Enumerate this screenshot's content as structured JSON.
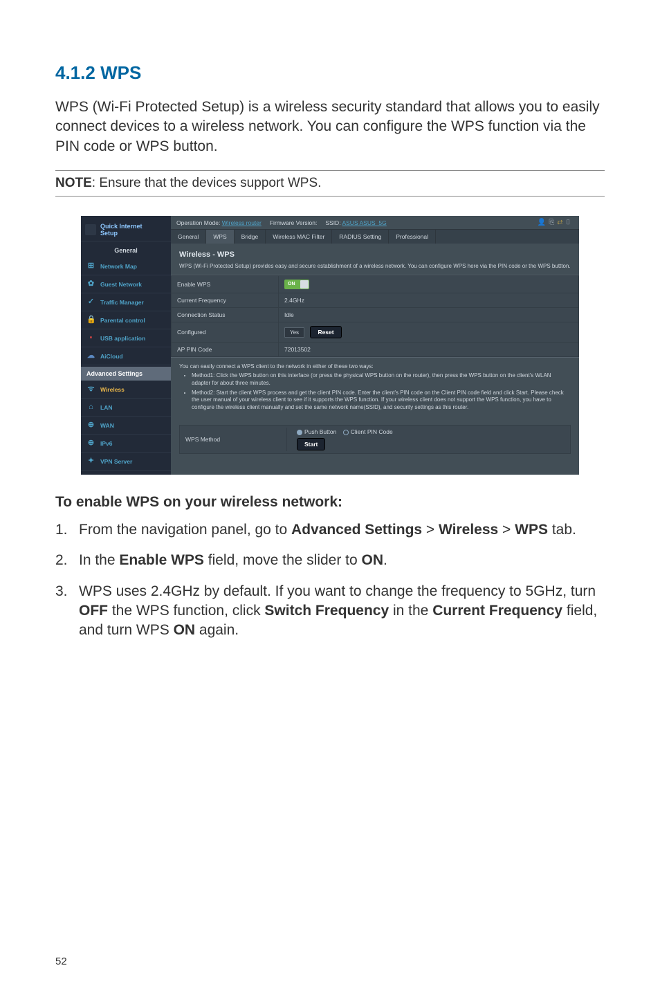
{
  "section": {
    "number": "4.1.2",
    "title": "WPS",
    "intro": "WPS (Wi-Fi Protected Setup) is a wireless security standard that allows you to easily connect devices to a wireless network. You can configure the WPS function via the PIN code or WPS button."
  },
  "note": {
    "label": "NOTE",
    "text": ":  Ensure that the devices support WPS."
  },
  "screenshot": {
    "sidebar": {
      "qis_l1": "Quick Internet",
      "qis_l2": "Setup",
      "group_general": "General",
      "items_general": [
        "Network Map",
        "Guest Network",
        "Traffic Manager",
        "Parental control",
        "USB application",
        "AiCloud"
      ],
      "group_adv": "Advanced Settings",
      "items_adv": [
        "Wireless",
        "LAN",
        "WAN",
        "IPv6",
        "VPN Server"
      ]
    },
    "topbar": {
      "opmode_label": "Operation Mode:",
      "opmode_value": "Wireless router",
      "fw_label": "Firmware Version:",
      "ssid_label": "SSID:",
      "ssid_value": "ASUS  ASUS_5G"
    },
    "tabs": [
      "General",
      "WPS",
      "Bridge",
      "Wireless MAC Filter",
      "RADIUS Setting",
      "Professional"
    ],
    "page_title": "Wireless - WPS",
    "page_desc": "WPS (Wi-Fi Protected Setup) provides easy and secure establishment of a wireless network. You can configure WPS here via the PIN code or the WPS buttton.",
    "rows": {
      "enable_wps": {
        "label": "Enable WPS",
        "value": "ON"
      },
      "current_freq": {
        "label": "Current Frequency",
        "value": "2.4GHz"
      },
      "conn_status": {
        "label": "Connection Status",
        "value": "Idle"
      },
      "configured": {
        "label": "Configured",
        "value": "Yes",
        "btn": "Reset"
      },
      "ap_pin": {
        "label": "AP PIN Code",
        "value": "72013502"
      }
    },
    "methods": {
      "intro": "You can easily connect a WPS client to the network in either of these two ways:",
      "m1": "Method1: Click the WPS button on this interface (or press the physical WPS button on the router), then press the WPS button on the client's WLAN adapter for about three minutes.",
      "m2": "Method2: Start the client WPS process and get the client PIN code. Enter the client's PIN code on the Client PIN code field and click Start. Please check the user manual of your wireless client to see if it supports the WPS function. If your wireless client does not support the WPS function, you have to configure the wireless client manually and set the same network name(SSID), and security settings as this router."
    },
    "wps_method": {
      "label": "WPS Method",
      "r1": "Push Button",
      "r2": "Client PIN Code",
      "start": "Start"
    }
  },
  "instructions": {
    "heading": "To enable WPS on your wireless network:",
    "step1_pre": "From the navigation panel, go to ",
    "step1_b1": "Advanced Settings",
    "step1_gt1": " > ",
    "step1_b2": "Wireless",
    "step1_gt2": " > ",
    "step1_b3": "WPS",
    "step1_post": " tab.",
    "step2_pre": "In the ",
    "step2_b1": "Enable WPS",
    "step2_mid": " field, move the slider to ",
    "step2_b2": "ON",
    "step2_post": ".",
    "step3_pre": "WPS uses 2.4GHz by default. If you want to change the frequency to 5GHz, turn ",
    "step3_b1": "OFF",
    "step3_m1": " the WPS function, click ",
    "step3_b2": "Switch Frequency",
    "step3_m2": " in the ",
    "step3_b3": "Current Frequency",
    "step3_m3": " field, and turn WPS ",
    "step3_b4": "ON",
    "step3_post": " again."
  },
  "page_number": "52"
}
